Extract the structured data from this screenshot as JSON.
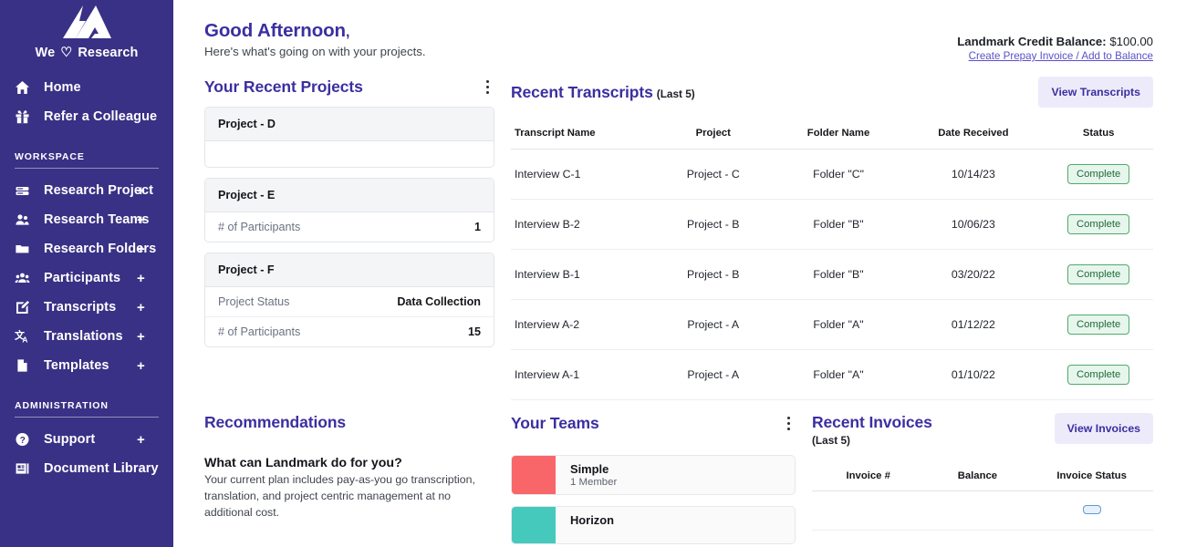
{
  "sidebar": {
    "logo_icon": "landmark-logo-icon",
    "brand_prefix": "We",
    "brand_heart": "♡",
    "brand_suffix": "Research",
    "top_items": [
      {
        "label": "Home",
        "icon": "home-icon",
        "plus": ""
      },
      {
        "label": "Refer a Colleague",
        "icon": "gift-icon",
        "plus": ""
      }
    ],
    "workspace_header": "WORKSPACE",
    "workspace_items": [
      {
        "label": "Research Project",
        "icon": "database-icon",
        "plus": "+"
      },
      {
        "label": "Research Teams",
        "icon": "people-icon",
        "plus": "+"
      },
      {
        "label": "Research Folders",
        "icon": "folder-icon",
        "plus": "+"
      },
      {
        "label": "Participants",
        "icon": "participants-icon",
        "plus": "+"
      },
      {
        "label": "Transcripts",
        "icon": "edit-note-icon",
        "plus": "+"
      },
      {
        "label": "Translations",
        "icon": "translate-icon",
        "plus": "+"
      },
      {
        "label": "Templates",
        "icon": "document-icon",
        "plus": "+"
      }
    ],
    "administration_header": "ADMINISTRATION",
    "administration_items": [
      {
        "label": "Support",
        "icon": "help-circle-icon",
        "plus": "+"
      },
      {
        "label": "Document Library",
        "icon": "library-icon",
        "plus": ""
      }
    ]
  },
  "header": {
    "greeting": "Good Afternoon",
    "greeting_comma": ",",
    "subtitle": "Here's what's going on with your projects.",
    "credit_label": "Landmark Credit Balance:",
    "credit_amount": "$100.00",
    "credit_link": "Create Prepay Invoice / Add to Balance"
  },
  "recent_projects": {
    "title": "Your Recent Projects",
    "menu_icon": "kebab-menu-icon",
    "cards": [
      {
        "name": "Project - D",
        "rows": []
      },
      {
        "name": "Project - E",
        "rows": [
          {
            "key": "# of Participants",
            "value": "1"
          }
        ]
      },
      {
        "name": "Project - F",
        "rows": [
          {
            "key": "Project Status",
            "value": "Data Collection"
          },
          {
            "key": "# of Participants",
            "value": "15"
          }
        ]
      }
    ]
  },
  "recent_transcripts": {
    "title": "Recent Transcripts",
    "subtitle": "(Last 5)",
    "action_label": "View Transcripts",
    "columns": [
      "Transcript Name",
      "Project",
      "Folder Name",
      "Date Received",
      "Status"
    ],
    "rows": [
      {
        "name": "Interview C-1",
        "project": "Project - C",
        "folder": "Folder \"C\"",
        "date": "10/14/23",
        "status": "Complete"
      },
      {
        "name": "Interview B-2",
        "project": "Project - B",
        "folder": "Folder \"B\"",
        "date": "10/06/23",
        "status": "Complete"
      },
      {
        "name": "Interview B-1",
        "project": "Project - B",
        "folder": "Folder \"B\"",
        "date": "03/20/22",
        "status": "Complete"
      },
      {
        "name": "Interview A-2",
        "project": "Project - A",
        "folder": "Folder \"A\"",
        "date": "01/12/22",
        "status": "Complete"
      },
      {
        "name": "Interview A-1",
        "project": "Project - A",
        "folder": "Folder \"A\"",
        "date": "01/10/22",
        "status": "Complete"
      }
    ]
  },
  "recommendations": {
    "title": "Recommendations",
    "card_title": "What can Landmark do for you?",
    "card_body": "Your current plan includes pay-as-you go transcription, translation, and project centric management at no additional cost."
  },
  "your_teams": {
    "title": "Your Teams",
    "menu_icon": "kebab-menu-icon",
    "teams": [
      {
        "name": "Simple",
        "members": "1 Member",
        "color": "#f8666a"
      },
      {
        "name": "Horizon",
        "members": "",
        "color": "#45c9bd"
      }
    ]
  },
  "recent_invoices": {
    "title": "Recent Invoices",
    "subtitle": "(Last 5)",
    "action_label": "View Invoices",
    "columns": [
      "Invoice #",
      "Balance",
      "Invoice Status"
    ],
    "rows": [
      {
        "number": "",
        "balance": "",
        "status": ""
      }
    ]
  },
  "colors": {
    "sidebar_bg": "#393185",
    "accent_indigo": "#3b2fa0",
    "button_light": "#edebfa",
    "badge_green_border": "#4faa6b",
    "badge_green_bg": "#e7f6ec",
    "badge_blue_border": "#5b9bd5"
  }
}
